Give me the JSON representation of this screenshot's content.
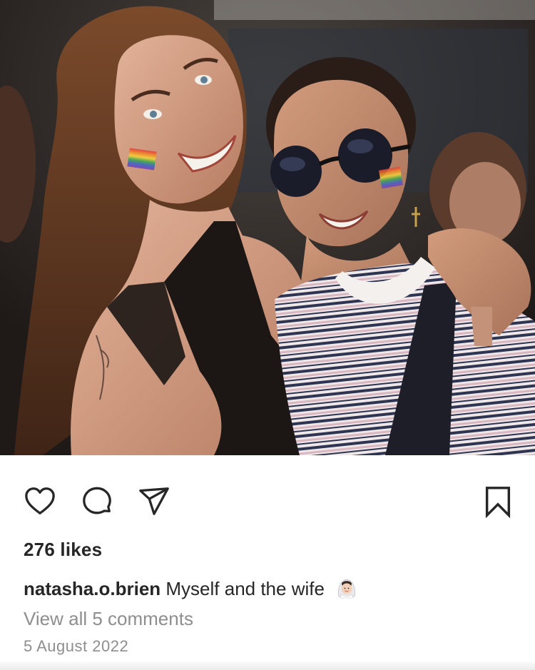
{
  "post": {
    "image": {
      "name": "post-photo",
      "colors": {
        "background": "#2a2624",
        "skin_left": "#d9a68b",
        "skin_right": "#c79272",
        "hair_left": "#6b3d22",
        "hair_right": "#2a1d17",
        "top_dark": "#1c1614",
        "stripe_navy": "#2e3552",
        "stripe_pink": "#d9b7c2",
        "shirt_white": "#f3f0ee"
      }
    },
    "actions": {
      "like_icon": "heart-outline-icon",
      "comment_icon": "speech-bubble-icon",
      "share_icon": "paper-plane-icon",
      "save_icon": "bookmark-icon"
    },
    "likes_text": "276 likes",
    "caption": {
      "username": "natasha.o.brien",
      "text": "Myself and the wife",
      "emoji": "bride-with-veil-emoji"
    },
    "comments_link": "View all 5 comments",
    "date": "5 August 2022"
  }
}
